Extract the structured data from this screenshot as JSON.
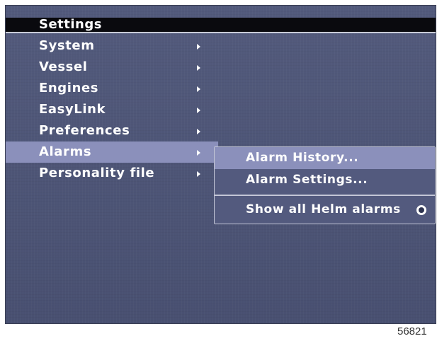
{
  "header": {
    "title": "Settings"
  },
  "menu": {
    "items": [
      {
        "label": "System",
        "has_submenu": true,
        "selected": false
      },
      {
        "label": "Vessel",
        "has_submenu": true,
        "selected": false
      },
      {
        "label": "Engines",
        "has_submenu": true,
        "selected": false
      },
      {
        "label": "EasyLink",
        "has_submenu": true,
        "selected": false
      },
      {
        "label": "Preferences",
        "has_submenu": true,
        "selected": false
      },
      {
        "label": "Alarms",
        "has_submenu": true,
        "selected": true
      },
      {
        "label": "Personality file",
        "has_submenu": true,
        "selected": false
      }
    ]
  },
  "submenu": {
    "items": [
      {
        "label": "Alarm History...",
        "selected": true
      },
      {
        "label": "Alarm Settings...",
        "selected": false
      }
    ],
    "toggle": {
      "label": "Show all Helm alarms",
      "icon": "radio-button-icon"
    }
  },
  "figure_number": "56821",
  "colors": {
    "screen_background": "#4d5578",
    "title_bar": "#0a0a0e",
    "highlight": "#8b90bb",
    "text": "#ffffff"
  }
}
